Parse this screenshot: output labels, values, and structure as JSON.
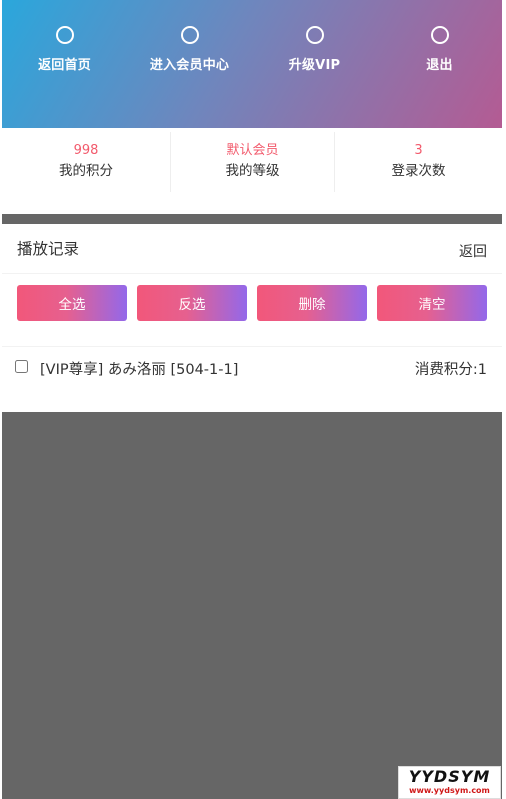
{
  "nav": {
    "items": [
      {
        "label": "返回首页",
        "icon": "circle-icon"
      },
      {
        "label": "进入会员中心",
        "icon": "circle-icon"
      },
      {
        "label": "升级VIP",
        "icon": "circle-icon"
      },
      {
        "label": "退出",
        "icon": "circle-icon"
      }
    ]
  },
  "stats": [
    {
      "value": "998",
      "label": "我的积分"
    },
    {
      "value": "默认会员",
      "label": "我的等级"
    },
    {
      "value": "3",
      "label": "登录次数"
    }
  ],
  "history": {
    "title": "播放记录",
    "back_label": "返回",
    "buttons": {
      "select_all": "全选",
      "invert": "反选",
      "delete": "删除",
      "clear": "清空"
    },
    "records": [
      {
        "title": "[VIP尊享] あみ洛丽 [504-1-1]",
        "cost": "消费积分:1"
      }
    ]
  },
  "watermark": {
    "logo": "YYDSYM",
    "url": "www.yydsym.com"
  },
  "colors": {
    "accent": "#f25a6c",
    "button_gradient_start": "#f2577a",
    "button_gradient_end": "#9368ea",
    "header_gradient_start": "#2aa7dc",
    "header_gradient_end": "#b45b93",
    "page_background": "#666666"
  }
}
